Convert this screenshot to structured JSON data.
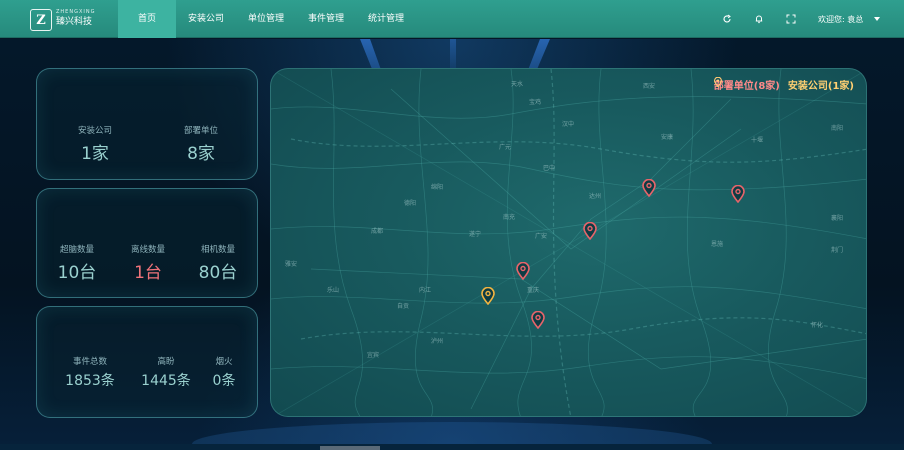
{
  "brand": {
    "logo_glyph": "Z",
    "name_en": "ZHENGXING",
    "name_cn": "臻兴科技"
  },
  "nav": {
    "items": [
      {
        "label": "首页",
        "active": true
      },
      {
        "label": "安装公司",
        "active": false
      },
      {
        "label": "单位管理",
        "active": false
      },
      {
        "label": "事件管理",
        "active": false
      },
      {
        "label": "统计管理",
        "active": false
      }
    ]
  },
  "header": {
    "icons": [
      "refresh-icon",
      "bell-icon",
      "fullscreen-icon"
    ],
    "welcome": "欢迎您: 袁总"
  },
  "stats": {
    "panel1": [
      {
        "label": "安装公司",
        "value": "1家"
      },
      {
        "label": "部署单位",
        "value": "8家"
      }
    ],
    "panel2": [
      {
        "label": "超脑数量",
        "value": "10台"
      },
      {
        "label": "离线数量",
        "value": "1台"
      },
      {
        "label": "相机数量",
        "value": "80台"
      }
    ],
    "panel3": [
      {
        "label": "事件总数",
        "value": "1853条"
      },
      {
        "label": "高盼",
        "value": "1445条"
      },
      {
        "label": "烟火",
        "value": "0条"
      }
    ]
  },
  "map": {
    "legend": {
      "units": "部署单位(8家)",
      "install": "安装公司(1家)"
    },
    "colors": {
      "unit_pin": "#e8646a",
      "install_pin": "#f2b441"
    },
    "cities": [
      "天水",
      "宝鸡",
      "西安",
      "汉中",
      "安康",
      "十堰",
      "广元",
      "巴中",
      "达州",
      "绵阳",
      "德阳",
      "南充",
      "成都",
      "遂宁",
      "广安",
      "雅安",
      "乐山",
      "内江",
      "重庆",
      "自贡",
      "宜宾",
      "泸州",
      "南阳",
      "恩施",
      "襄阳",
      "荆门",
      "怀化"
    ]
  }
}
